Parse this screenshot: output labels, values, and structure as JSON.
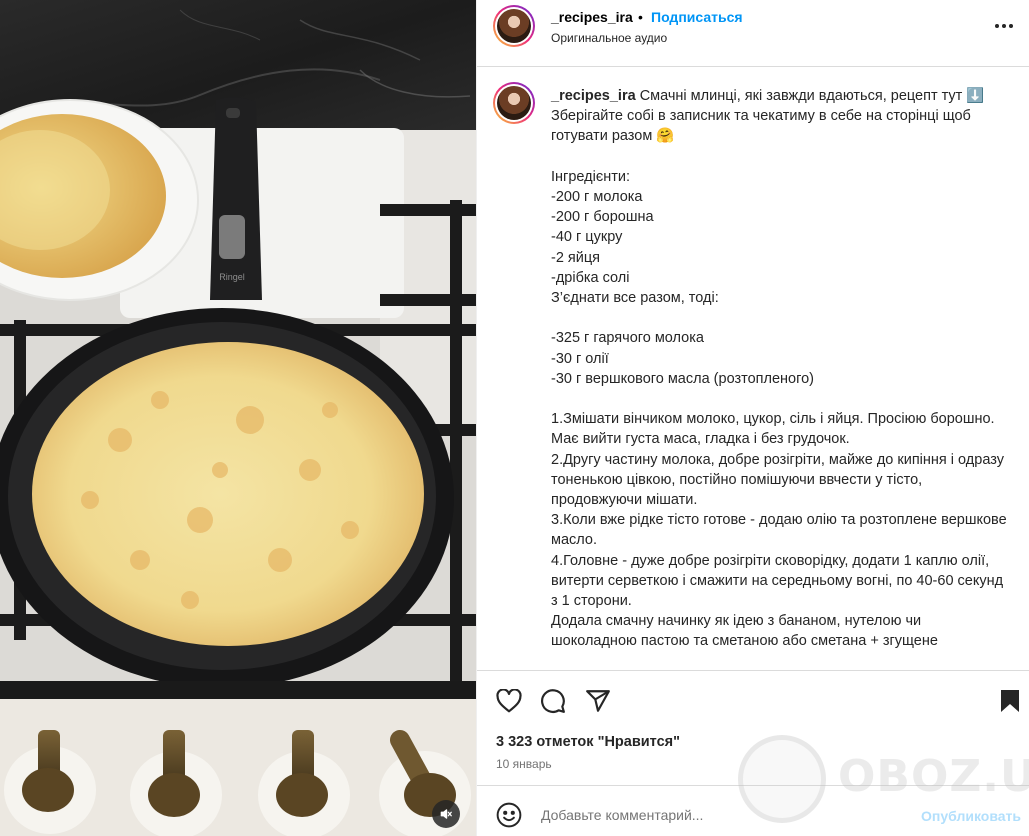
{
  "post": {
    "username": "_recipes_ira",
    "separator": "•",
    "follow_label": "Подписаться",
    "audio": "Оригинальное аудио",
    "more_icon": "more-horizontal-icon"
  },
  "caption": {
    "username": "_recipes_ira",
    "text": "Смачні млинці, які завжди вдаються, рецепт тут ⬇️\nЗберігайте собі в записник та чекатиму в себе на сторінці щоб готувати разом 🤗\n\nІнгредієнти:\n-200 г молока\n-200 г борошна\n-40 г цукру\n-2 яйця\n-дрібка солі\nЗ’єднати все разом, тоді:\n\n-325 г гарячого молока\n-30 г олії\n-30 г вершкового масла (розтопленого)\n\n1.Змішати вінчиком молоко, цукор, сіль і яйця. Просіюю борошно. Має вийти густа маса, гладка і без грудочок.\n2.Другу частину молока, добре розігріти, майже до кипіння і одразу тоненькою цівкою, постійно помішуючи ввчести у тісто, продовжуючи мішати.\n3.Коли вже рідке тісто готове - додаю олію та розтоплене вершкове масло.\n4.Головне - дуже добре розігріти сковорідку, додати 1 каплю олії, витерти серветкою і смажити на середньому вогні, по 40-60 секунд з 1 сторони.\nДодала смачну начинку як ідею з бананом, нутелою чи шоколадною пастою та сметаною або сметана + згущене"
  },
  "actions": {
    "like_icon": "heart-icon",
    "comment_icon": "comment-icon",
    "share_icon": "share-icon",
    "save_icon": "bookmark-icon",
    "likes": "3 323 отметок \"Нравится\"",
    "date": "10 январь"
  },
  "comment": {
    "emoji_icon": "emoji-icon",
    "placeholder": "Добавьте комментарий...",
    "publish_label": "Опубликовать"
  },
  "media": {
    "pan_brand": "Ringel",
    "mute_icon": "volume-muted-icon"
  },
  "watermark": {
    "text": "OBOZ.UA"
  },
  "colors": {
    "link": "#0095f6",
    "publish_disabled": "#b2dffc",
    "text": "#262626",
    "muted": "#737373"
  }
}
